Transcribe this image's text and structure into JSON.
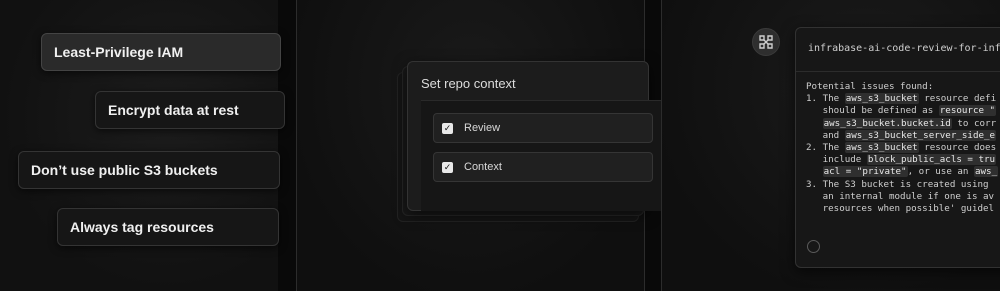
{
  "rules_panel": {
    "chips": [
      "Least-Privilege IAM",
      "Encrypt data at rest",
      "Don’t use public S3 buckets",
      "Always tag resources"
    ]
  },
  "context_panel": {
    "title": "Set repo context",
    "options": [
      {
        "label": "Review",
        "checked": true
      },
      {
        "label": "Context",
        "checked": true
      }
    ]
  },
  "review_panel": {
    "header": "infrabase-ai-code-review-for-infra",
    "lines": [
      [
        {
          "t": "Potential issues found:"
        }
      ],
      [
        {
          "t": "1. The "
        },
        {
          "t": "aws_s3_bucket",
          "c": true
        },
        {
          "t": " resource defi"
        }
      ],
      [
        {
          "t": "   should be defined as "
        },
        {
          "t": "resource \"",
          "c": true
        }
      ],
      [
        {
          "t": "   "
        },
        {
          "t": "aws_s3_bucket.bucket.id",
          "c": true
        },
        {
          "t": " to corr"
        }
      ],
      [
        {
          "t": "   and "
        },
        {
          "t": "aws_s3_bucket_server_side_e",
          "c": true
        }
      ],
      [
        {
          "t": "2. The "
        },
        {
          "t": "aws_s3_bucket",
          "c": true
        },
        {
          "t": " resource does"
        }
      ],
      [
        {
          "t": "   include "
        },
        {
          "t": "block_public_acls = tru",
          "c": true
        }
      ],
      [
        {
          "t": "   "
        },
        {
          "t": "acl = \"private\"",
          "c": true
        },
        {
          "t": ", or use an "
        },
        {
          "t": "aws_",
          "c": true
        }
      ],
      [
        {
          "t": "3. The S3 bucket is created using"
        }
      ],
      [
        {
          "t": "   an internal module if one is av"
        }
      ],
      [
        {
          "t": "   resources when possible' guidel"
        }
      ]
    ]
  },
  "icons": {
    "checkbox": "check-icon",
    "avatar": "infrabase-logo-icon",
    "reaction": "emoji-icon"
  }
}
